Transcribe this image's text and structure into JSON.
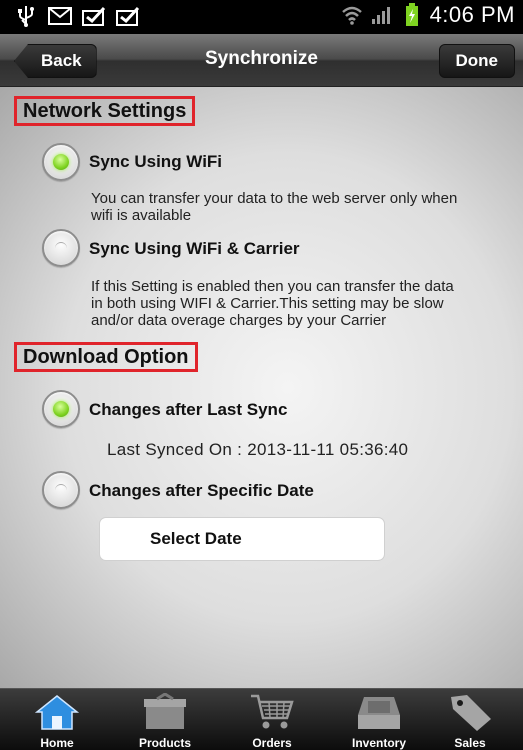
{
  "status_bar": {
    "icons": [
      "usb-icon",
      "mail-icon",
      "check-icon",
      "check-icon"
    ],
    "right_icons": [
      "wifi-icon",
      "signal-icon",
      "battery-charging-icon"
    ],
    "time": "4:06 PM"
  },
  "nav": {
    "back_label": "Back",
    "title": "Synchronize",
    "done_label": "Done"
  },
  "network_settings": {
    "title": "Network Settings",
    "options": [
      {
        "label": "Sync Using WiFi",
        "selected": true,
        "description_line1": "You can transfer your data to the web server only when",
        "description_line2": "wifi is available"
      },
      {
        "label": "Sync Using WiFi & Carrier",
        "selected": false,
        "description_line1": "If this Setting is enabled then you can transfer the data",
        "description_line2": "in both using WIFI & Carrier.This setting may be slow",
        "description_line3": "and/or data overage charges by your Carrier"
      }
    ]
  },
  "download_option": {
    "title": "Download Option",
    "options": [
      {
        "label": "Changes after Last Sync",
        "selected": true
      },
      {
        "label": "Changes after Specific Date",
        "selected": false
      }
    ],
    "last_synced": "Last Synced On : 2013-11-11 05:36:40",
    "select_date_label": "Select Date"
  },
  "tabs": [
    {
      "label": "Home",
      "icon": "home-icon",
      "active": true
    },
    {
      "label": "Products",
      "icon": "box-icon",
      "active": false
    },
    {
      "label": "Orders",
      "icon": "cart-icon",
      "active": false
    },
    {
      "label": "Inventory",
      "icon": "inventory-tray-icon",
      "active": false
    },
    {
      "label": "Sales",
      "icon": "tag-icon",
      "active": false
    }
  ],
  "colors": {
    "highlight_border": "#e0242b",
    "radio_selected": "#7fd321",
    "home_tab_accent": "#2e8ee0"
  }
}
